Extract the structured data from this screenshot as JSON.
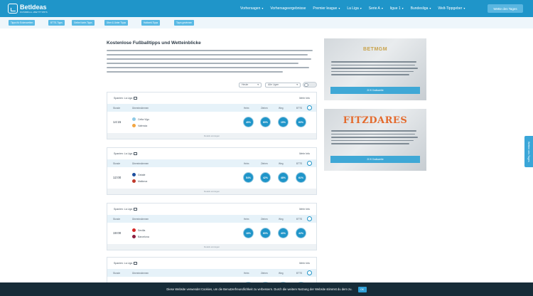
{
  "brand": {
    "name": "BetIdeas",
    "tagline": "FUSSBALL-WETTTIPPS"
  },
  "nav": {
    "items": [
      {
        "label": "Vorhersagen",
        "chev": true
      },
      {
        "label": "Vorhersageergebnisse",
        "chev": false
      },
      {
        "label": "Premier league",
        "chev": true
      },
      {
        "label": "La Liga",
        "chev": true
      },
      {
        "label": "Serie A",
        "chev": true
      },
      {
        "label": "ligue 1",
        "chev": true
      },
      {
        "label": "Bundesliga",
        "chev": true
      },
      {
        "label": "Welt-Tippgeber",
        "chev": true
      }
    ],
    "cta": "Wette des Tages",
    "chevron": "▾"
  },
  "subnav": {
    "chips": [
      "Tipps für Eckenwetten",
      "BTTS-Tipps",
      "Gelbe Karte-Tipps",
      "Über & Unter Tipps",
      "Halbzeit-Tipps",
      "Tipps gewinnen"
    ]
  },
  "page": {
    "title": "Kostenlose Fußballtipps und Wetteinblicke"
  },
  "filters": {
    "date_value": "Heute",
    "league_value": "Alle Ligen",
    "select_chevron": "▾"
  },
  "table": {
    "columns": [
      "Stunde",
      "Übereinstimmen",
      "Heim",
      "Ziehen",
      "Weg",
      "BTTS"
    ],
    "show_more": "Details anzeigen",
    "more_info": "Mehr Info",
    "league": "Spanien: La Liga"
  },
  "matches": [
    {
      "time": "14:15",
      "home": "Celta Vigo",
      "away": "Valencia",
      "home_color": "#8ecae6",
      "away_color": "#f2a541",
      "pcts": [
        "45%",
        "60%",
        "15%",
        "60%"
      ]
    },
    {
      "time": "12:00",
      "home": "Getafe",
      "away": "Mallorca",
      "home_color": "#1d4e9e",
      "away_color": "#c0392b",
      "pcts": [
        "54%",
        "42%",
        "48%",
        "61%"
      ]
    },
    {
      "time": "19:00",
      "home": "Sevilla",
      "away": "Barcelona",
      "home_color": "#d62828",
      "away_color": "#8b1e3f",
      "pcts": [
        "18%",
        "60%",
        "40%",
        "42%"
      ]
    },
    {
      "time": "",
      "home": "",
      "away": "",
      "home_color": "#1d4e9e",
      "away_color": "#d62828",
      "pcts": [
        "",
        "",
        "",
        ""
      ]
    }
  ],
  "ads": [
    {
      "brand": "BETMGM",
      "button": "20 € Gratiswette",
      "brand_color": "#c8a24a"
    },
    {
      "brand": "FITZDARES",
      "button": "20 € Gratiswette",
      "brand_color": "#e46a2c"
    }
  ],
  "side_tab": {
    "label": "Wetten des Tages"
  },
  "cookie": {
    "text": "Diese Website verwendet Cookies, um die Benutzerfreundlichkeit zu verbessern. Durch die weitere Nutzung der Website stimmst du dem zu.",
    "ok": "OK"
  }
}
